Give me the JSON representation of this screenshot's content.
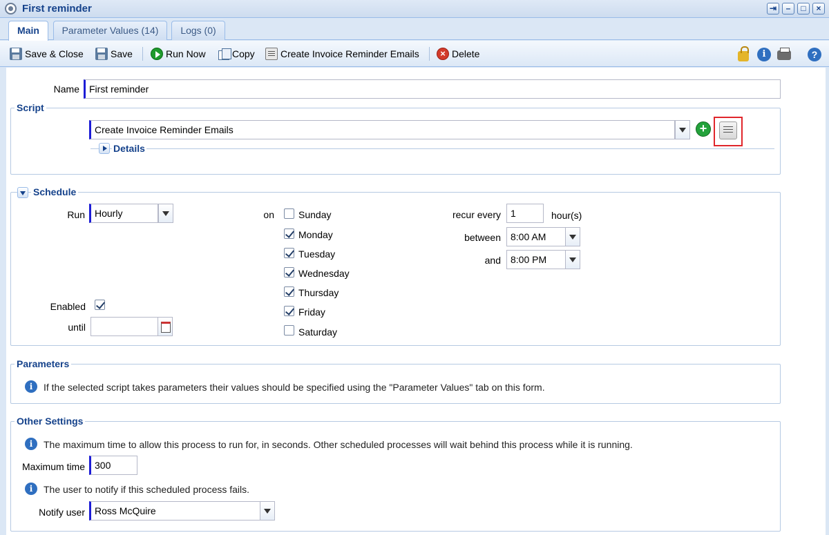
{
  "window": {
    "title": "First reminder"
  },
  "tabs": [
    {
      "label": "Main",
      "active": true
    },
    {
      "label": "Parameter Values (14)",
      "active": false
    },
    {
      "label": "Logs (0)",
      "active": false
    }
  ],
  "toolbar": {
    "save_close": "Save & Close",
    "save": "Save",
    "run_now": "Run Now",
    "copy": "Copy",
    "create_emails": "Create Invoice Reminder Emails",
    "delete": "Delete"
  },
  "form": {
    "name_label": "Name",
    "name_value": "First reminder"
  },
  "script": {
    "legend": "Script",
    "selected": "Create Invoice Reminder Emails",
    "details_label": "Details"
  },
  "schedule": {
    "legend": "Schedule",
    "run_label": "Run",
    "run_value": "Hourly",
    "on_label": "on",
    "days": [
      {
        "label": "Sunday",
        "checked": false
      },
      {
        "label": "Monday",
        "checked": true
      },
      {
        "label": "Tuesday",
        "checked": true
      },
      {
        "label": "Wednesday",
        "checked": true
      },
      {
        "label": "Thursday",
        "checked": true
      },
      {
        "label": "Friday",
        "checked": true
      },
      {
        "label": "Saturday",
        "checked": false
      }
    ],
    "recur_label": "recur every",
    "recur_value": "1",
    "recur_unit": "hour(s)",
    "between_label": "between",
    "between_value": "8:00 AM",
    "and_label": "and",
    "and_value": "8:00 PM",
    "enabled_label": "Enabled",
    "enabled_checked": true,
    "until_label": "until",
    "until_value": ""
  },
  "parameters": {
    "legend": "Parameters",
    "note": "If the selected script takes parameters their values should be specified using the \"Parameter Values\" tab on this form."
  },
  "other": {
    "legend": "Other Settings",
    "max_note": "The maximum time to allow this process to run for, in seconds. Other scheduled processes will wait behind this process while it is running.",
    "max_label": "Maximum time",
    "max_value": "300",
    "notify_note": "The user to notify if this scheduled process fails.",
    "notify_label": "Notify user",
    "notify_value": "Ross McQuire"
  },
  "colors": {
    "accent": "#15428b",
    "required_bar": "#1d1dd6",
    "highlight": "#e0262b"
  }
}
